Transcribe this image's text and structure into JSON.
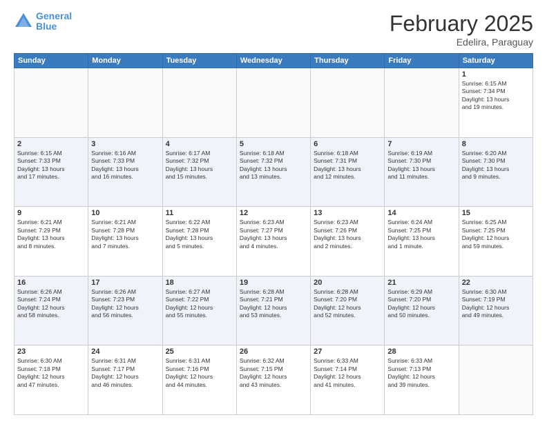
{
  "logo": {
    "line1": "General",
    "line2": "Blue"
  },
  "header": {
    "month": "February 2025",
    "location": "Edelira, Paraguay"
  },
  "weekdays": [
    "Sunday",
    "Monday",
    "Tuesday",
    "Wednesday",
    "Thursday",
    "Friday",
    "Saturday"
  ],
  "weeks": [
    [
      {
        "day": "",
        "info": ""
      },
      {
        "day": "",
        "info": ""
      },
      {
        "day": "",
        "info": ""
      },
      {
        "day": "",
        "info": ""
      },
      {
        "day": "",
        "info": ""
      },
      {
        "day": "",
        "info": ""
      },
      {
        "day": "1",
        "info": "Sunrise: 6:15 AM\nSunset: 7:34 PM\nDaylight: 13 hours\nand 19 minutes."
      }
    ],
    [
      {
        "day": "2",
        "info": "Sunrise: 6:15 AM\nSunset: 7:33 PM\nDaylight: 13 hours\nand 17 minutes."
      },
      {
        "day": "3",
        "info": "Sunrise: 6:16 AM\nSunset: 7:33 PM\nDaylight: 13 hours\nand 16 minutes."
      },
      {
        "day": "4",
        "info": "Sunrise: 6:17 AM\nSunset: 7:32 PM\nDaylight: 13 hours\nand 15 minutes."
      },
      {
        "day": "5",
        "info": "Sunrise: 6:18 AM\nSunset: 7:32 PM\nDaylight: 13 hours\nand 13 minutes."
      },
      {
        "day": "6",
        "info": "Sunrise: 6:18 AM\nSunset: 7:31 PM\nDaylight: 13 hours\nand 12 minutes."
      },
      {
        "day": "7",
        "info": "Sunrise: 6:19 AM\nSunset: 7:30 PM\nDaylight: 13 hours\nand 11 minutes."
      },
      {
        "day": "8",
        "info": "Sunrise: 6:20 AM\nSunset: 7:30 PM\nDaylight: 13 hours\nand 9 minutes."
      }
    ],
    [
      {
        "day": "9",
        "info": "Sunrise: 6:21 AM\nSunset: 7:29 PM\nDaylight: 13 hours\nand 8 minutes."
      },
      {
        "day": "10",
        "info": "Sunrise: 6:21 AM\nSunset: 7:28 PM\nDaylight: 13 hours\nand 7 minutes."
      },
      {
        "day": "11",
        "info": "Sunrise: 6:22 AM\nSunset: 7:28 PM\nDaylight: 13 hours\nand 5 minutes."
      },
      {
        "day": "12",
        "info": "Sunrise: 6:23 AM\nSunset: 7:27 PM\nDaylight: 13 hours\nand 4 minutes."
      },
      {
        "day": "13",
        "info": "Sunrise: 6:23 AM\nSunset: 7:26 PM\nDaylight: 13 hours\nand 2 minutes."
      },
      {
        "day": "14",
        "info": "Sunrise: 6:24 AM\nSunset: 7:25 PM\nDaylight: 13 hours\nand 1 minute."
      },
      {
        "day": "15",
        "info": "Sunrise: 6:25 AM\nSunset: 7:25 PM\nDaylight: 12 hours\nand 59 minutes."
      }
    ],
    [
      {
        "day": "16",
        "info": "Sunrise: 6:26 AM\nSunset: 7:24 PM\nDaylight: 12 hours\nand 58 minutes."
      },
      {
        "day": "17",
        "info": "Sunrise: 6:26 AM\nSunset: 7:23 PM\nDaylight: 12 hours\nand 56 minutes."
      },
      {
        "day": "18",
        "info": "Sunrise: 6:27 AM\nSunset: 7:22 PM\nDaylight: 12 hours\nand 55 minutes."
      },
      {
        "day": "19",
        "info": "Sunrise: 6:28 AM\nSunset: 7:21 PM\nDaylight: 12 hours\nand 53 minutes."
      },
      {
        "day": "20",
        "info": "Sunrise: 6:28 AM\nSunset: 7:20 PM\nDaylight: 12 hours\nand 52 minutes."
      },
      {
        "day": "21",
        "info": "Sunrise: 6:29 AM\nSunset: 7:20 PM\nDaylight: 12 hours\nand 50 minutes."
      },
      {
        "day": "22",
        "info": "Sunrise: 6:30 AM\nSunset: 7:19 PM\nDaylight: 12 hours\nand 49 minutes."
      }
    ],
    [
      {
        "day": "23",
        "info": "Sunrise: 6:30 AM\nSunset: 7:18 PM\nDaylight: 12 hours\nand 47 minutes."
      },
      {
        "day": "24",
        "info": "Sunrise: 6:31 AM\nSunset: 7:17 PM\nDaylight: 12 hours\nand 46 minutes."
      },
      {
        "day": "25",
        "info": "Sunrise: 6:31 AM\nSunset: 7:16 PM\nDaylight: 12 hours\nand 44 minutes."
      },
      {
        "day": "26",
        "info": "Sunrise: 6:32 AM\nSunset: 7:15 PM\nDaylight: 12 hours\nand 43 minutes."
      },
      {
        "day": "27",
        "info": "Sunrise: 6:33 AM\nSunset: 7:14 PM\nDaylight: 12 hours\nand 41 minutes."
      },
      {
        "day": "28",
        "info": "Sunrise: 6:33 AM\nSunset: 7:13 PM\nDaylight: 12 hours\nand 39 minutes."
      },
      {
        "day": "",
        "info": ""
      }
    ]
  ]
}
